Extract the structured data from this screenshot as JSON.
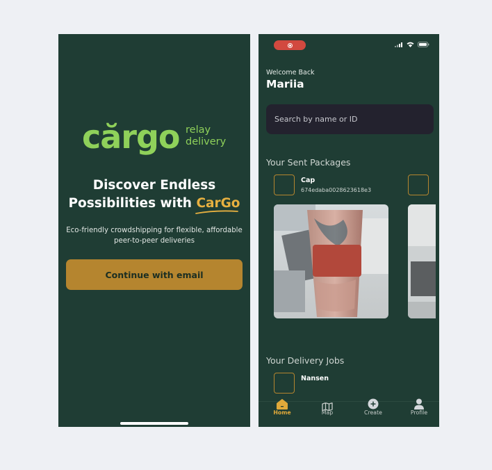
{
  "onboarding": {
    "logo_word": "cărgo",
    "logo_sub_line1": "relay",
    "logo_sub_line2": "delivery",
    "headline_line1": "Discover Endless",
    "headline_line2_prefix": "Possibilities with",
    "headline_brand": "CarGo",
    "tagline_line1": "Eco-friendly crowdshipping for flexible, affordable",
    "tagline_line2": "peer-to-peer deliveries",
    "cta_label": "Continue with email"
  },
  "home": {
    "welcome": "Welcome Back",
    "user_name": "Mariia",
    "search_placeholder": "Search by name or ID",
    "sent_title": "Your Sent Packages",
    "sent_packages": [
      {
        "name": "Cap",
        "id": "674edaba0028623618e3"
      }
    ],
    "delivery_title": "Your Delivery Jobs",
    "delivery_jobs": [
      {
        "name": "Nansen"
      }
    ],
    "nav": {
      "home": "Home",
      "map": "Map",
      "create": "Create",
      "profile": "Profile"
    }
  },
  "colors": {
    "screen_bg": "#1f3d34",
    "brand_green": "#8fd15a",
    "accent_gold": "#b5852f",
    "record_red": "#d2493f"
  }
}
